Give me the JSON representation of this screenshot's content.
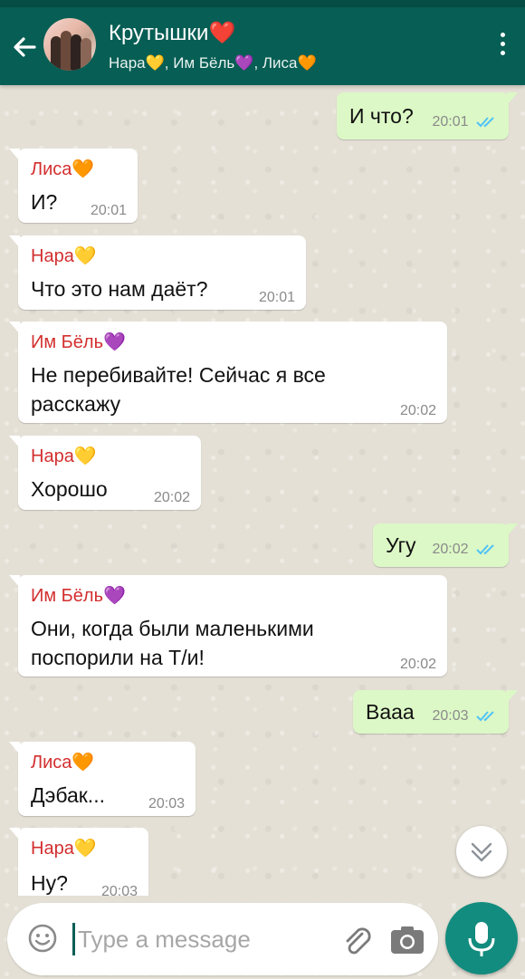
{
  "header": {
    "title": "Крутышки❤️",
    "subtitle": "Нара💛, Им Бёль💜, Лиса🧡",
    "back_icon": "arrow-left-icon",
    "menu_icon": "more-vert-icon",
    "color": "#075e54"
  },
  "messages": [
    {
      "direction": "out",
      "text": "И что?",
      "time": "20:01",
      "status": "read"
    },
    {
      "direction": "in",
      "sender": "Лиса🧡",
      "text": "И?",
      "time": "20:01"
    },
    {
      "direction": "in",
      "sender": "Нара💛",
      "text": "Что это нам даёт?",
      "time": "20:01"
    },
    {
      "direction": "in",
      "sender": "Им Бёль💜",
      "lines": [
        "Не перебивайте! Сейчас я все",
        "расскажу"
      ],
      "time": "20:02"
    },
    {
      "direction": "in",
      "sender": "Нара💛",
      "text": "Хорошо",
      "time": "20:02"
    },
    {
      "direction": "out",
      "text": "Угу",
      "time": "20:02",
      "status": "read"
    },
    {
      "direction": "in",
      "sender": "Им Бёль💜",
      "lines": [
        "Они, когда были маленькими",
        "поспорили на Т/и!"
      ],
      "time": "20:02"
    },
    {
      "direction": "out",
      "text": "Вааа",
      "time": "20:03",
      "status": "read"
    },
    {
      "direction": "in",
      "sender": "Лиса🧡",
      "text": "Дэбак...",
      "time": "20:03"
    },
    {
      "direction": "in",
      "sender": "Нара💛",
      "text": "Ну?",
      "time": "20:03"
    }
  ],
  "composer": {
    "placeholder": "Type a message",
    "emoji_icon": "emoji-icon",
    "attach_icon": "paperclip-icon",
    "camera_icon": "camera-icon",
    "mic_icon": "microphone-icon"
  },
  "scroll_down_icon": "chevrons-down-icon",
  "colors": {
    "outgoing_bubble": "#dcf8c6",
    "incoming_bubble": "#ffffff",
    "sender_name": "#d32f2f",
    "read_ticks": "#4fc3f7",
    "mic_button": "#128c7e"
  }
}
